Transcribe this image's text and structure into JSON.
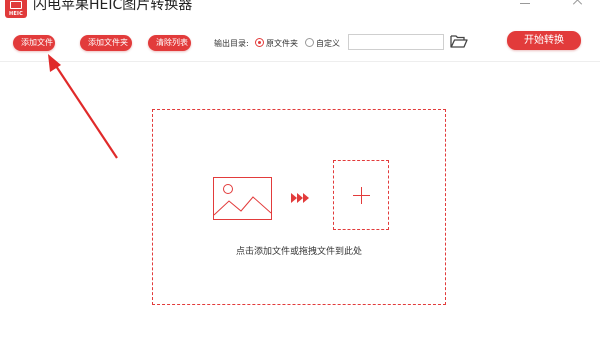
{
  "app": {
    "logo_text": "HEIC",
    "title": "闪电苹果HEIC图片转换器"
  },
  "toolbar": {
    "add_file_label": "添加文件",
    "add_folder_label": "添加文件夹",
    "clear_list_label": "清除列表",
    "output_dir_label": "输出目录:",
    "output_options": [
      {
        "label": "原文件夹",
        "selected": true
      },
      {
        "label": "自定义",
        "selected": false
      }
    ],
    "path_value": "",
    "start_label": "开始转换"
  },
  "drop_zone": {
    "hint": "点击添加文件或拖拽文件到此处"
  },
  "icons": {
    "logo": "heic-logo-icon",
    "folder": "folder-open-icon",
    "image": "image-icon",
    "arrows": "triple-arrow-icon",
    "plus": "plus-icon",
    "annotation": "annotation-arrow-icon"
  },
  "colors": {
    "accent": "#e23b3b",
    "text": "#333333",
    "background": "#ffffff"
  }
}
